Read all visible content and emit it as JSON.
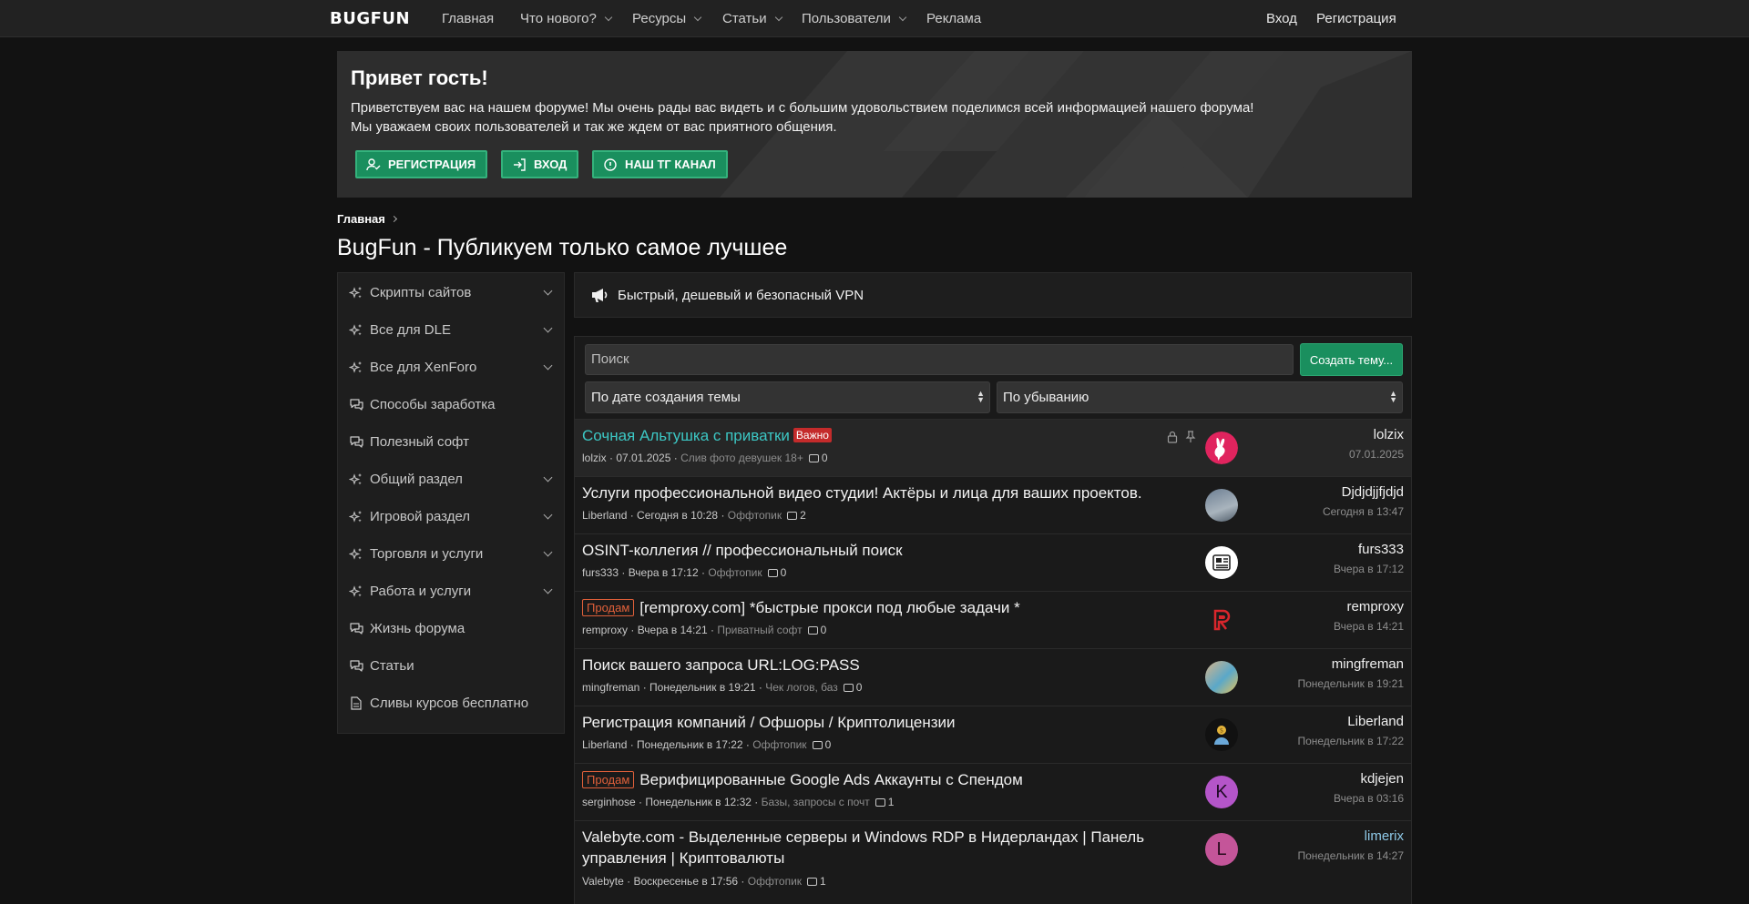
{
  "nav": {
    "logo": "BUGFUN",
    "items": [
      {
        "label": "Главная"
      },
      {
        "label": "Что нового?"
      },
      {
        "label": "Ресурсы"
      },
      {
        "label": "Статьи"
      },
      {
        "label": "Пользователи"
      },
      {
        "label": "Реклама"
      }
    ],
    "login": "Вход",
    "register": "Регистрация"
  },
  "banner": {
    "title": "Привет гость!",
    "line1": "Приветствуем вас на нашем форуме! Мы очень рады вас видеть и с большим удовольствием поделимся всей информацией нашего форума!",
    "line2": "Мы уважаем своих пользователей и так же ждем от вас приятного общения.",
    "buttons": {
      "register": "РЕГИСТРАЦИЯ",
      "login": "ВХОД",
      "tg": "НАШ ТГ КАНАЛ"
    }
  },
  "breadcrumb": "Главная",
  "page_title": "BugFun - Публикуем только самое лучшее",
  "sidebar": {
    "items": [
      {
        "label": "Скрипты сайтов"
      },
      {
        "label": "Все для DLE"
      },
      {
        "label": "Все для XenForo"
      },
      {
        "label": "Способы заработка"
      },
      {
        "label": "Полезный софт"
      },
      {
        "label": "Общий раздел"
      },
      {
        "label": "Игровой раздел"
      },
      {
        "label": "Торговля и услуги"
      },
      {
        "label": "Работа и услуги"
      },
      {
        "label": "Жизнь форума"
      },
      {
        "label": "Статьи"
      },
      {
        "label": "Сливы курсов бесплатно"
      }
    ]
  },
  "promo": "Быстрый, дешевый и безопасный VPN",
  "threads_panel": {
    "search_placeholder": "Поиск",
    "create_button": "Создать тему...",
    "sort_by": "По дате создания темы",
    "sort_order": "По убыванию"
  },
  "threads": [
    {
      "prefix": "",
      "title": "Сочная Альтушка с приватки",
      "badge": "Важно",
      "author": "lolzix",
      "date": "07.01.2025",
      "forum": "Слив фото девушек 18+",
      "replies": "0",
      "last_user": "lolzix",
      "last_date": "07.01.2025"
    },
    {
      "prefix": "",
      "title": " Услуги профессиональной видео студии! Актёры и лица для ваших проектов.",
      "badge": "",
      "author": "Liberland",
      "date": "Сегодня в 10:28",
      "forum": "Оффтопик",
      "replies": "2",
      "last_user": "Djdjdjjfjdjd",
      "last_date": "Сегодня в 13:47"
    },
    {
      "prefix": "",
      "title": "OSINT-коллегия // профессиональный поиск",
      "badge": "",
      "author": "furs333",
      "date": "Вчера в 17:12",
      "forum": "Оффтопик",
      "replies": "0",
      "last_user": "furs333",
      "last_date": "Вчера в 17:12"
    },
    {
      "prefix": "Продам",
      "title": "[remproxy.com] *быстрые прокси под любые задачи *",
      "badge": "",
      "author": "remproxy",
      "date": "Вчера в 14:21",
      "forum": "Приватный софт",
      "replies": "0",
      "last_user": "remproxy",
      "last_date": "Вчера в 14:21"
    },
    {
      "prefix": "",
      "title": "Поиск вашего запроса URL:LOG:PASS",
      "badge": "",
      "author": "mingfreman",
      "date": "Понедельник в 19:21",
      "forum": "Чек логов, баз",
      "replies": "0",
      "last_user": "mingfreman",
      "last_date": "Понедельник в 19:21"
    },
    {
      "prefix": "",
      "title": "Регистрация компаний / Офшоры / Криптолицензии",
      "badge": "",
      "author": "Liberland",
      "date": "Понедельник в 17:22",
      "forum": "Оффтопик",
      "replies": "0",
      "last_user": "Liberland",
      "last_date": "Понедельник в 17:22"
    },
    {
      "prefix": "Продам",
      "title": "Верифицированные Google Ads Аккаунты с Спендом",
      "badge": "",
      "author": "serginhose",
      "date": "Понедельник в 12:32",
      "forum": "Базы, запросы с почт",
      "replies": "1",
      "last_user": "kdjejen",
      "last_date": "Вчера в 03:16"
    },
    {
      "prefix": "",
      "title": " Valebyte.com - Выделенные серверы и Windows RDP в Нидерландах | Панель",
      "title2": "управления | Криптовалюты ",
      "badge": "",
      "author": "Valebyte",
      "date": "Воскресенье в 17:56",
      "forum": "Оффтопик",
      "replies": "1",
      "last_user": "limerix",
      "last_date": "Понедельник в 14:27"
    }
  ],
  "avatars": [
    {
      "letter": "",
      "color": "#e0245e"
    },
    {
      "letter": "",
      "color": "#7b8b9c"
    },
    {
      "letter": "",
      "color": "#ffffff"
    },
    {
      "letter": "",
      "color": "#1a1a1a"
    },
    {
      "letter": "",
      "color": "#c0a888"
    },
    {
      "letter": "",
      "color": "#111111"
    },
    {
      "letter": "K",
      "color": "#b455c9"
    },
    {
      "letter": "L",
      "color": "#c45599"
    }
  ],
  "colors": {
    "accent_green": "#1a8f5e",
    "title_accent": "#3cc7c4",
    "important_red": "#c42b2b",
    "sell_orange": "#e0603a",
    "limerix_link": "#8ec9e8"
  }
}
